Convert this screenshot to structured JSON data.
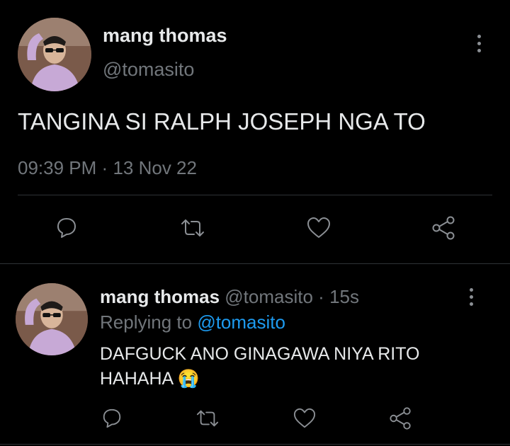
{
  "main_tweet": {
    "display_name": "mang thomas",
    "handle": "@tomasito",
    "text": "TANGINA SI RALPH JOSEPH NGA TO",
    "time": "09:39 PM",
    "separator": "·",
    "date": "13 Nov 22"
  },
  "reply": {
    "display_name": "mang thomas",
    "handle": "@tomasito",
    "separator": "·",
    "age": "15s",
    "replying_to_label": "Replying to",
    "replying_to_handle": "@tomasito",
    "text_line1": "DAFGUCK ANO GINAGAWA NIYA RITO",
    "text_line2": "HAHAHA",
    "emoji": "😭"
  },
  "icons": {
    "reply": "reply-icon",
    "retweet": "retweet-icon",
    "like": "heart-icon",
    "share": "share-icon",
    "more": "more-vertical-icon"
  },
  "colors": {
    "background": "#000000",
    "text": "#e7e9ea",
    "muted": "#71767b",
    "link": "#1d9bf0",
    "divider": "#2f3336"
  }
}
